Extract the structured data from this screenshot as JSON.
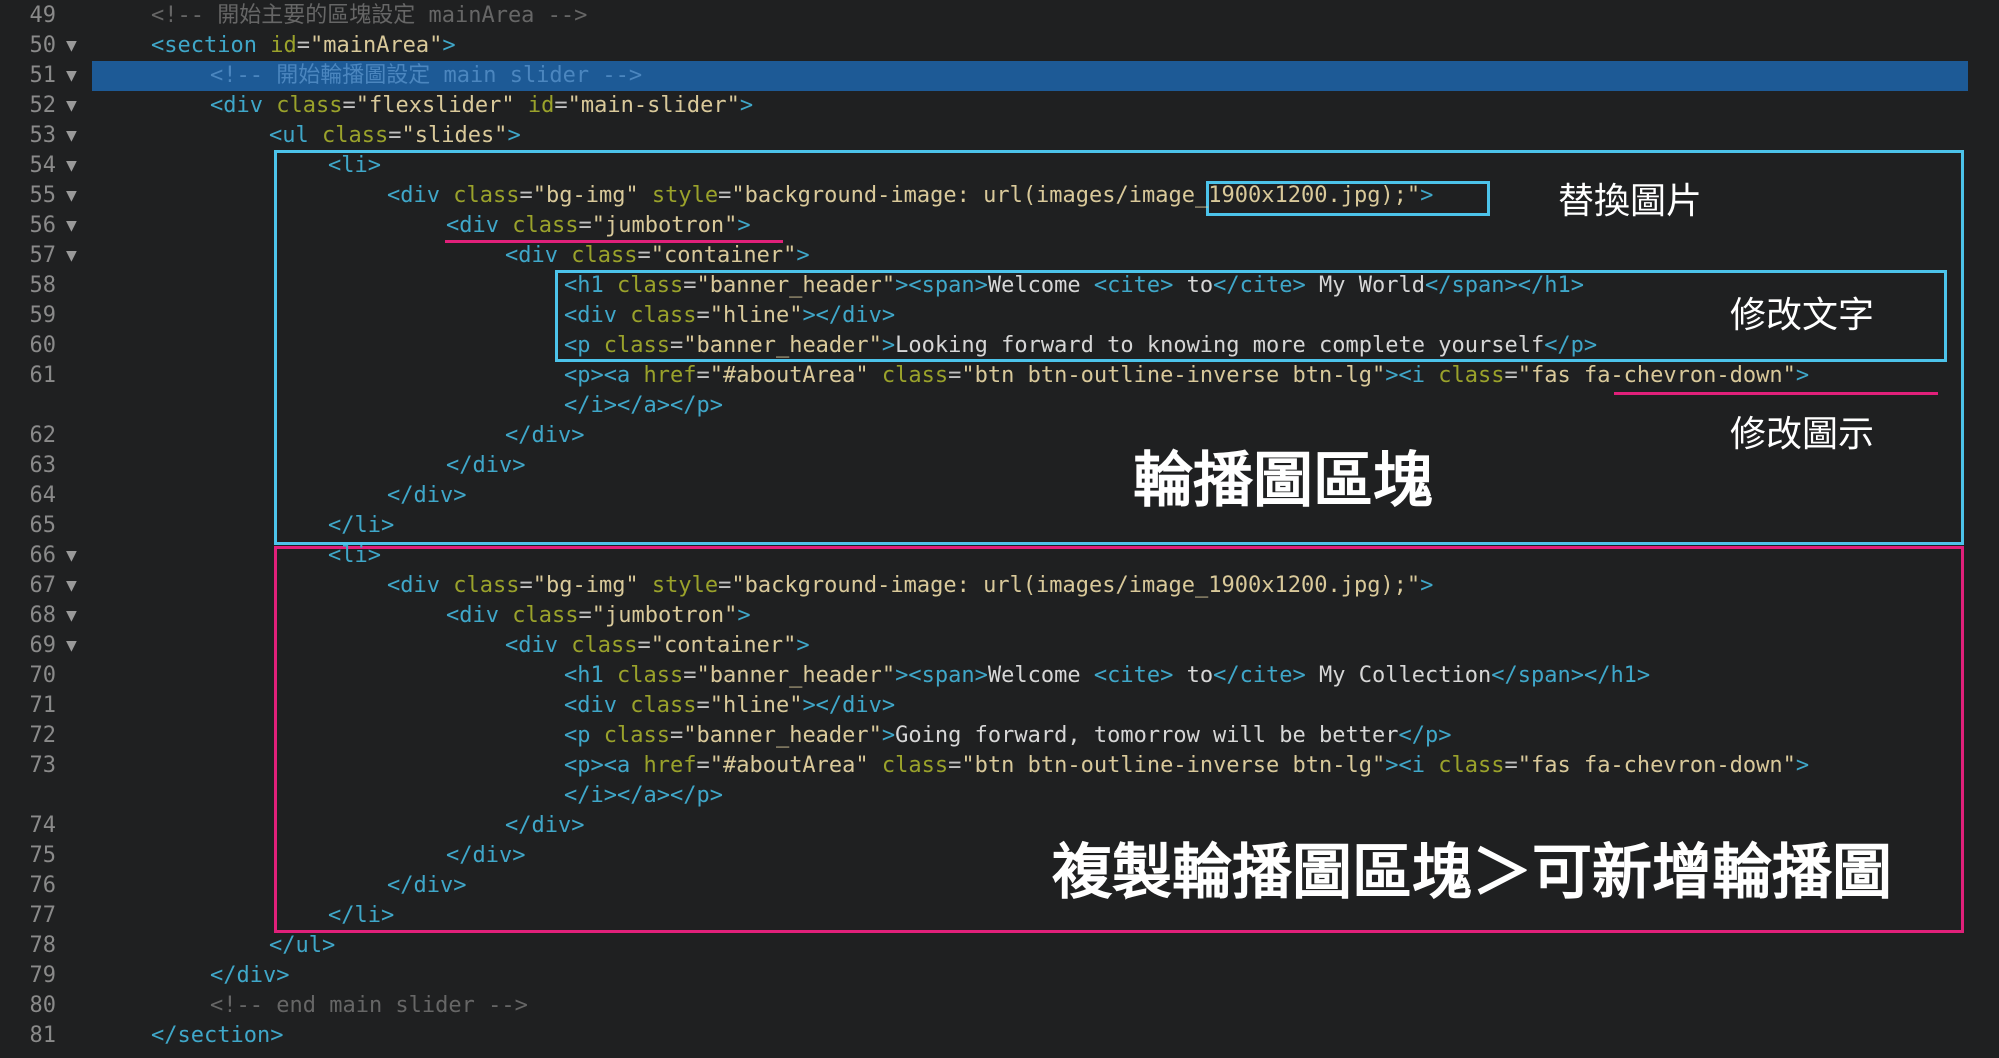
{
  "colors": {
    "background": "#1f2021",
    "selection": "#1d5a96",
    "tag": "#3fa7c9",
    "attribute": "#9aa22b",
    "string": "#d9c99a",
    "comment": "#666666",
    "callout_blue": "#4cc3ea",
    "callout_pink": "#e0207a"
  },
  "fold_glyph": "▼",
  "selected_line": "51",
  "lines": [
    {
      "num": "49",
      "fold": false,
      "indent": 1,
      "tokens": [
        [
          "cm",
          "<!-- 開始主要的區塊設定 mainArea -->"
        ]
      ]
    },
    {
      "num": "50",
      "fold": true,
      "indent": 1,
      "tokens": [
        [
          "tag",
          "<section "
        ],
        [
          "attr",
          "id"
        ],
        [
          "eq",
          "="
        ],
        [
          "str",
          "\"mainArea\""
        ],
        [
          "tag",
          ">"
        ]
      ]
    },
    {
      "num": "51",
      "fold": true,
      "indent": 2,
      "highlight": true,
      "tokens": [
        [
          "cm",
          "<!-- 開始輪播圖設定 main slider -->"
        ]
      ]
    },
    {
      "num": "52",
      "fold": true,
      "indent": 2,
      "tokens": [
        [
          "tag",
          "<div "
        ],
        [
          "attr",
          "class"
        ],
        [
          "eq",
          "="
        ],
        [
          "str",
          "\"flexslider\""
        ],
        [
          "attr",
          " id"
        ],
        [
          "eq",
          "="
        ],
        [
          "str",
          "\"main-slider\""
        ],
        [
          "tag",
          ">"
        ]
      ]
    },
    {
      "num": "53",
      "fold": true,
      "indent": 3,
      "tokens": [
        [
          "tag",
          "<ul "
        ],
        [
          "attr",
          "class"
        ],
        [
          "eq",
          "="
        ],
        [
          "str",
          "\"slides\""
        ],
        [
          "tag",
          ">"
        ]
      ]
    },
    {
      "num": "54",
      "fold": true,
      "indent": 4,
      "tokens": [
        [
          "tag",
          "<li>"
        ]
      ]
    },
    {
      "num": "55",
      "fold": true,
      "indent": 5,
      "tokens": [
        [
          "tag",
          "<div "
        ],
        [
          "attr",
          "class"
        ],
        [
          "eq",
          "="
        ],
        [
          "str",
          "\"bg-img\""
        ],
        [
          "attr",
          " style"
        ],
        [
          "eq",
          "="
        ],
        [
          "str",
          "\"background-image: url(images/image_1900x1200.jpg);\""
        ],
        [
          "tag",
          ">"
        ]
      ]
    },
    {
      "num": "56",
      "fold": true,
      "indent": 6,
      "tokens": [
        [
          "tag",
          "<div "
        ],
        [
          "attr",
          "class"
        ],
        [
          "eq",
          "="
        ],
        [
          "str",
          "\"jumbotron\""
        ],
        [
          "tag",
          ">"
        ]
      ]
    },
    {
      "num": "57",
      "fold": true,
      "indent": 7,
      "tokens": [
        [
          "tag",
          "<div "
        ],
        [
          "attr",
          "class"
        ],
        [
          "eq",
          "="
        ],
        [
          "str",
          "\"container\""
        ],
        [
          "tag",
          ">"
        ]
      ]
    },
    {
      "num": "58",
      "fold": false,
      "indent": 8,
      "tokens": [
        [
          "tag",
          "<h1 "
        ],
        [
          "attr",
          "class"
        ],
        [
          "eq",
          "="
        ],
        [
          "str",
          "\"banner_header\""
        ],
        [
          "tag",
          "><span>"
        ],
        [
          "txt",
          "Welcome "
        ],
        [
          "tag",
          "<cite>"
        ],
        [
          "txt",
          " to"
        ],
        [
          "tag",
          "</cite>"
        ],
        [
          "txt",
          " My World"
        ],
        [
          "tag",
          "</span></h1>"
        ]
      ]
    },
    {
      "num": "59",
      "fold": false,
      "indent": 8,
      "tokens": [
        [
          "tag",
          "<div "
        ],
        [
          "attr",
          "class"
        ],
        [
          "eq",
          "="
        ],
        [
          "str",
          "\"hline\""
        ],
        [
          "tag",
          "></div>"
        ]
      ]
    },
    {
      "num": "60",
      "fold": false,
      "indent": 8,
      "tokens": [
        [
          "tag",
          "<p "
        ],
        [
          "attr",
          "class"
        ],
        [
          "eq",
          "="
        ],
        [
          "str",
          "\"banner_header\""
        ],
        [
          "tag",
          ">"
        ],
        [
          "txt",
          "Looking forward to knowing more complete yourself"
        ],
        [
          "tag",
          "</p>"
        ]
      ]
    },
    {
      "num": "61",
      "fold": false,
      "indent": 8,
      "tokens": [
        [
          "tag",
          "<p><a "
        ],
        [
          "attr",
          "href"
        ],
        [
          "eq",
          "="
        ],
        [
          "str",
          "\"#aboutArea\""
        ],
        [
          "attr",
          " class"
        ],
        [
          "eq",
          "="
        ],
        [
          "str",
          "\"btn btn-outline-inverse btn-lg\""
        ],
        [
          "tag",
          "><i "
        ],
        [
          "attr",
          "class"
        ],
        [
          "eq",
          "="
        ],
        [
          "str",
          "\"fas fa-chevron-down\""
        ],
        [
          "tag",
          ">"
        ]
      ]
    },
    {
      "num": "",
      "fold": false,
      "indent": 8,
      "tokens": [
        [
          "tag",
          "</i></a></p>"
        ]
      ]
    },
    {
      "num": "62",
      "fold": false,
      "indent": 7,
      "tokens": [
        [
          "tag",
          "</div>"
        ]
      ]
    },
    {
      "num": "63",
      "fold": false,
      "indent": 6,
      "tokens": [
        [
          "tag",
          "</div>"
        ]
      ]
    },
    {
      "num": "64",
      "fold": false,
      "indent": 5,
      "tokens": [
        [
          "tag",
          "</div>"
        ]
      ]
    },
    {
      "num": "65",
      "fold": false,
      "indent": 4,
      "tokens": [
        [
          "tag",
          "</li>"
        ]
      ]
    },
    {
      "num": "66",
      "fold": true,
      "indent": 4,
      "tokens": [
        [
          "tag",
          "<li>"
        ]
      ]
    },
    {
      "num": "67",
      "fold": true,
      "indent": 5,
      "tokens": [
        [
          "tag",
          "<div "
        ],
        [
          "attr",
          "class"
        ],
        [
          "eq",
          "="
        ],
        [
          "str",
          "\"bg-img\""
        ],
        [
          "attr",
          " style"
        ],
        [
          "eq",
          "="
        ],
        [
          "str",
          "\"background-image: url(images/image_1900x1200.jpg);\""
        ],
        [
          "tag",
          ">"
        ]
      ]
    },
    {
      "num": "68",
      "fold": true,
      "indent": 6,
      "tokens": [
        [
          "tag",
          "<div "
        ],
        [
          "attr",
          "class"
        ],
        [
          "eq",
          "="
        ],
        [
          "str",
          "\"jumbotron\""
        ],
        [
          "tag",
          ">"
        ]
      ]
    },
    {
      "num": "69",
      "fold": true,
      "indent": 7,
      "tokens": [
        [
          "tag",
          "<div "
        ],
        [
          "attr",
          "class"
        ],
        [
          "eq",
          "="
        ],
        [
          "str",
          "\"container\""
        ],
        [
          "tag",
          ">"
        ]
      ]
    },
    {
      "num": "70",
      "fold": false,
      "indent": 8,
      "tokens": [
        [
          "tag",
          "<h1 "
        ],
        [
          "attr",
          "class"
        ],
        [
          "eq",
          "="
        ],
        [
          "str",
          "\"banner_header\""
        ],
        [
          "tag",
          "><span>"
        ],
        [
          "txt",
          "Welcome "
        ],
        [
          "tag",
          "<cite>"
        ],
        [
          "txt",
          " to"
        ],
        [
          "tag",
          "</cite>"
        ],
        [
          "txt",
          " My Collection"
        ],
        [
          "tag",
          "</span></h1>"
        ]
      ]
    },
    {
      "num": "71",
      "fold": false,
      "indent": 8,
      "tokens": [
        [
          "tag",
          "<div "
        ],
        [
          "attr",
          "class"
        ],
        [
          "eq",
          "="
        ],
        [
          "str",
          "\"hline\""
        ],
        [
          "tag",
          "></div>"
        ]
      ]
    },
    {
      "num": "72",
      "fold": false,
      "indent": 8,
      "tokens": [
        [
          "tag",
          "<p "
        ],
        [
          "attr",
          "class"
        ],
        [
          "eq",
          "="
        ],
        [
          "str",
          "\"banner_header\""
        ],
        [
          "tag",
          ">"
        ],
        [
          "txt",
          "Going forward, tomorrow will be better"
        ],
        [
          "tag",
          "</p>"
        ]
      ]
    },
    {
      "num": "73",
      "fold": false,
      "indent": 8,
      "tokens": [
        [
          "tag",
          "<p><a "
        ],
        [
          "attr",
          "href"
        ],
        [
          "eq",
          "="
        ],
        [
          "str",
          "\"#aboutArea\""
        ],
        [
          "attr",
          " class"
        ],
        [
          "eq",
          "="
        ],
        [
          "str",
          "\"btn btn-outline-inverse btn-lg\""
        ],
        [
          "tag",
          "><i "
        ],
        [
          "attr",
          "class"
        ],
        [
          "eq",
          "="
        ],
        [
          "str",
          "\"fas fa-chevron-down\""
        ],
        [
          "tag",
          ">"
        ]
      ]
    },
    {
      "num": "",
      "fold": false,
      "indent": 8,
      "tokens": [
        [
          "tag",
          "</i></a></p>"
        ]
      ]
    },
    {
      "num": "74",
      "fold": false,
      "indent": 7,
      "tokens": [
        [
          "tag",
          "</div>"
        ]
      ]
    },
    {
      "num": "75",
      "fold": false,
      "indent": 6,
      "tokens": [
        [
          "tag",
          "</div>"
        ]
      ]
    },
    {
      "num": "76",
      "fold": false,
      "indent": 5,
      "tokens": [
        [
          "tag",
          "</div>"
        ]
      ]
    },
    {
      "num": "77",
      "fold": false,
      "indent": 4,
      "tokens": [
        [
          "tag",
          "</li>"
        ]
      ]
    },
    {
      "num": "78",
      "fold": false,
      "indent": 3,
      "tokens": [
        [
          "tag",
          "</ul>"
        ]
      ]
    },
    {
      "num": "79",
      "fold": false,
      "indent": 2,
      "tokens": [
        [
          "tag",
          "</div>"
        ]
      ]
    },
    {
      "num": "80",
      "fold": false,
      "indent": 2,
      "tokens": [
        [
          "cm",
          "<!-- end main slider -->"
        ]
      ]
    },
    {
      "num": "81",
      "fold": false,
      "indent": 1,
      "tokens": [
        [
          "tag",
          "</section>"
        ]
      ]
    }
  ],
  "annotations": {
    "replace_image": "替換圖片",
    "edit_text": "修改文字",
    "edit_icon": "修改圖示",
    "slider_block": "輪播圖區塊",
    "copy_block": "複製輪播圖區塊＞可新增輪播圖"
  }
}
